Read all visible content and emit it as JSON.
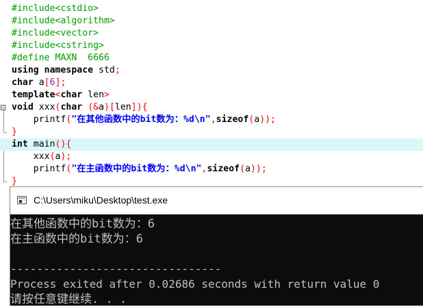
{
  "editor": {
    "lines": [
      {
        "hl": false,
        "fold": "",
        "tokens": [
          {
            "c": "pp",
            "t": "#include<cstdio>"
          }
        ]
      },
      {
        "hl": false,
        "fold": "",
        "tokens": [
          {
            "c": "pp",
            "t": "#include<algorithm>"
          }
        ]
      },
      {
        "hl": false,
        "fold": "",
        "tokens": [
          {
            "c": "pp",
            "t": "#include<vector>"
          }
        ]
      },
      {
        "hl": false,
        "fold": "",
        "tokens": [
          {
            "c": "pp",
            "t": "#include<cstring>"
          }
        ]
      },
      {
        "hl": false,
        "fold": "",
        "tokens": [
          {
            "c": "pp",
            "t": "#define MAXN  6666"
          }
        ]
      },
      {
        "hl": false,
        "fold": "",
        "tokens": [
          {
            "c": "kw",
            "t": "using namespace "
          },
          {
            "c": "id",
            "t": "std"
          },
          {
            "c": "op",
            "t": ";"
          }
        ]
      },
      {
        "hl": false,
        "fold": "",
        "tokens": [
          {
            "c": "kw",
            "t": "char "
          },
          {
            "c": "id",
            "t": "a"
          },
          {
            "c": "op",
            "t": "["
          },
          {
            "c": "num",
            "t": "6"
          },
          {
            "c": "op",
            "t": "];"
          }
        ]
      },
      {
        "hl": false,
        "fold": "",
        "tokens": [
          {
            "c": "kw",
            "t": "template"
          },
          {
            "c": "op",
            "t": "<"
          },
          {
            "c": "kw",
            "t": "char "
          },
          {
            "c": "id",
            "t": "len"
          },
          {
            "c": "op",
            "t": ">"
          }
        ]
      },
      {
        "hl": false,
        "fold": "open",
        "tokens": [
          {
            "c": "kw",
            "t": "void "
          },
          {
            "c": "id",
            "t": "xxx"
          },
          {
            "c": "op",
            "t": "("
          },
          {
            "c": "kw",
            "t": "char "
          },
          {
            "c": "op",
            "t": "(&"
          },
          {
            "c": "id",
            "t": "a"
          },
          {
            "c": "op",
            "t": ")["
          },
          {
            "c": "id",
            "t": "len"
          },
          {
            "c": "op",
            "t": "]){"
          }
        ]
      },
      {
        "hl": false,
        "fold": "line",
        "tokens": [
          {
            "c": "id",
            "t": "    printf"
          },
          {
            "c": "op",
            "t": "("
          },
          {
            "c": "str",
            "t": "\"在其他函数中的bit数为：%d\\n\""
          },
          {
            "c": "op",
            "t": ","
          },
          {
            "c": "kw",
            "t": "sizeof"
          },
          {
            "c": "op",
            "t": "("
          },
          {
            "c": "id",
            "t": "a"
          },
          {
            "c": "op",
            "t": "));"
          }
        ]
      },
      {
        "hl": false,
        "fold": "end",
        "tokens": [
          {
            "c": "op",
            "t": "}"
          }
        ]
      },
      {
        "hl": true,
        "fold": "open",
        "tokens": [
          {
            "c": "kw",
            "t": "int "
          },
          {
            "c": "id",
            "t": "main"
          },
          {
            "c": "op",
            "t": "(){"
          }
        ]
      },
      {
        "hl": false,
        "fold": "line",
        "tokens": [
          {
            "c": "id",
            "t": "    xxx"
          },
          {
            "c": "op",
            "t": "("
          },
          {
            "c": "id",
            "t": "a"
          },
          {
            "c": "op",
            "t": ");"
          }
        ]
      },
      {
        "hl": false,
        "fold": "line",
        "tokens": [
          {
            "c": "id",
            "t": "    printf"
          },
          {
            "c": "op",
            "t": "("
          },
          {
            "c": "str",
            "t": "\"在主函数中的bit数为：%d\\n\""
          },
          {
            "c": "op",
            "t": ","
          },
          {
            "c": "kw",
            "t": "sizeof"
          },
          {
            "c": "op",
            "t": "("
          },
          {
            "c": "id",
            "t": "a"
          },
          {
            "c": "op",
            "t": "));"
          }
        ]
      },
      {
        "hl": false,
        "fold": "end",
        "tokens": [
          {
            "c": "op",
            "t": "}"
          }
        ]
      }
    ]
  },
  "console": {
    "title": "C:\\Users\\miku\\Desktop\\test.exe",
    "icon": "console-window-icon",
    "output": [
      "在其他函数中的bit数为：6",
      "在主函数中的bit数为：6",
      "",
      "--------------------------------",
      "Process exited after 0.02686 seconds with return value 0",
      "请按任意键继续. . ."
    ]
  },
  "colors": {
    "preprocessor": "#00a000",
    "operator": "#ff0000",
    "number": "#8a1ab8",
    "string": "#0000ff",
    "current_line": "#d7f7fb",
    "terminal_bg": "#0c0c0c",
    "terminal_fg": "#c0c0c0"
  }
}
